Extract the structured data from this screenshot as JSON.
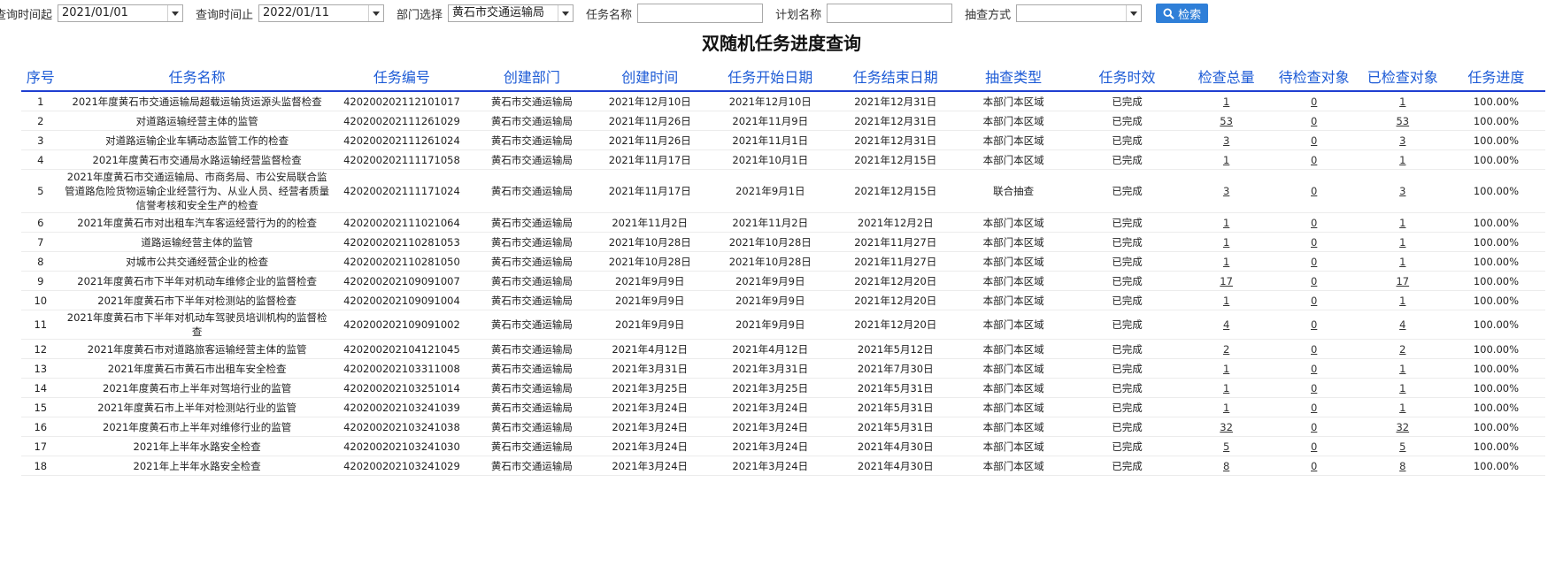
{
  "filters": {
    "start_label": "查询时间起",
    "start_value": "2021/01/01",
    "end_label": "查询时间止",
    "end_value": "2022/01/11",
    "dept_label": "部门选择",
    "dept_value": "黄石市交通运输局",
    "task_name_label": "任务名称",
    "task_name_value": "",
    "plan_name_label": "计划名称",
    "plan_name_value": "",
    "method_label": "抽查方式",
    "method_value": "",
    "search_label": "检索"
  },
  "title": "双随机任务进度查询",
  "columns": [
    "序号",
    "任务名称",
    "任务编号",
    "创建部门",
    "创建时间",
    "任务开始日期",
    "任务结束日期",
    "抽查类型",
    "任务时效",
    "检查总量",
    "待检查对象",
    "已检查对象",
    "任务进度"
  ],
  "rows": [
    {
      "no": "1",
      "name": "2021年度黄石市交通运输局超载运输货运源头监督检查",
      "code": "420200202112101017",
      "dept": "黄石市交通运输局",
      "created": "2021年12月10日",
      "start": "2021年12月10日",
      "end": "2021年12月31日",
      "type": "本部门本区域",
      "status": "已完成",
      "total": "1",
      "pending": "0",
      "checked": "1",
      "progress": "100.00%"
    },
    {
      "no": "2",
      "name": "对道路运输经营主体的监管",
      "code": "420200202111261029",
      "dept": "黄石市交通运输局",
      "created": "2021年11月26日",
      "start": "2021年11月9日",
      "end": "2021年12月31日",
      "type": "本部门本区域",
      "status": "已完成",
      "total": "53",
      "pending": "0",
      "checked": "53",
      "progress": "100.00%"
    },
    {
      "no": "3",
      "name": "对道路运输企业车辆动态监管工作的检查",
      "code": "420200202111261024",
      "dept": "黄石市交通运输局",
      "created": "2021年11月26日",
      "start": "2021年11月1日",
      "end": "2021年12月31日",
      "type": "本部门本区域",
      "status": "已完成",
      "total": "3",
      "pending": "0",
      "checked": "3",
      "progress": "100.00%"
    },
    {
      "no": "4",
      "name": "2021年度黄石市交通局水路运输经营监督检查",
      "code": "420200202111171058",
      "dept": "黄石市交通运输局",
      "created": "2021年11月17日",
      "start": "2021年10月1日",
      "end": "2021年12月15日",
      "type": "本部门本区域",
      "status": "已完成",
      "total": "1",
      "pending": "0",
      "checked": "1",
      "progress": "100.00%"
    },
    {
      "no": "5",
      "name": "2021年度黄石市交通运输局、市商务局、市公安局联合监管道路危险货物运输企业经营行为、从业人员、经营者质量信誉考核和安全生产的检查",
      "code": "420200202111171024",
      "dept": "黄石市交通运输局",
      "created": "2021年11月17日",
      "start": "2021年9月1日",
      "end": "2021年12月15日",
      "type": "联合抽查",
      "status": "已完成",
      "total": "3",
      "pending": "0",
      "checked": "3",
      "progress": "100.00%"
    },
    {
      "no": "6",
      "name": "2021年度黄石市对出租车汽车客运经营行为的的检查",
      "code": "420200202111021064",
      "dept": "黄石市交通运输局",
      "created": "2021年11月2日",
      "start": "2021年11月2日",
      "end": "2021年12月2日",
      "type": "本部门本区域",
      "status": "已完成",
      "total": "1",
      "pending": "0",
      "checked": "1",
      "progress": "100.00%"
    },
    {
      "no": "7",
      "name": "道路运输经营主体的监管",
      "code": "420200202110281053",
      "dept": "黄石市交通运输局",
      "created": "2021年10月28日",
      "start": "2021年10月28日",
      "end": "2021年11月27日",
      "type": "本部门本区域",
      "status": "已完成",
      "total": "1",
      "pending": "0",
      "checked": "1",
      "progress": "100.00%"
    },
    {
      "no": "8",
      "name": "对城市公共交通经营企业的检查",
      "code": "420200202110281050",
      "dept": "黄石市交通运输局",
      "created": "2021年10月28日",
      "start": "2021年10月28日",
      "end": "2021年11月27日",
      "type": "本部门本区域",
      "status": "已完成",
      "total": "1",
      "pending": "0",
      "checked": "1",
      "progress": "100.00%"
    },
    {
      "no": "9",
      "name": "2021年度黄石市下半年对机动车维修企业的监督检查",
      "code": "420200202109091007",
      "dept": "黄石市交通运输局",
      "created": "2021年9月9日",
      "start": "2021年9月9日",
      "end": "2021年12月20日",
      "type": "本部门本区域",
      "status": "已完成",
      "total": "17",
      "pending": "0",
      "checked": "17",
      "progress": "100.00%"
    },
    {
      "no": "10",
      "name": "2021年度黄石市下半年对检测站的监督检查",
      "code": "420200202109091004",
      "dept": "黄石市交通运输局",
      "created": "2021年9月9日",
      "start": "2021年9月9日",
      "end": "2021年12月20日",
      "type": "本部门本区域",
      "status": "已完成",
      "total": "1",
      "pending": "0",
      "checked": "1",
      "progress": "100.00%"
    },
    {
      "no": "11",
      "name": "2021年度黄石市下半年对机动车驾驶员培训机构的监督检查",
      "code": "420200202109091002",
      "dept": "黄石市交通运输局",
      "created": "2021年9月9日",
      "start": "2021年9月9日",
      "end": "2021年12月20日",
      "type": "本部门本区域",
      "status": "已完成",
      "total": "4",
      "pending": "0",
      "checked": "4",
      "progress": "100.00%"
    },
    {
      "no": "12",
      "name": "2021年度黄石市对道路旅客运输经营主体的监管",
      "code": "420200202104121045",
      "dept": "黄石市交通运输局",
      "created": "2021年4月12日",
      "start": "2021年4月12日",
      "end": "2021年5月12日",
      "type": "本部门本区域",
      "status": "已完成",
      "total": "2",
      "pending": "0",
      "checked": "2",
      "progress": "100.00%"
    },
    {
      "no": "13",
      "name": "2021年度黄石市黄石市出租车安全检查",
      "code": "420200202103311008",
      "dept": "黄石市交通运输局",
      "created": "2021年3月31日",
      "start": "2021年3月31日",
      "end": "2021年7月30日",
      "type": "本部门本区域",
      "status": "已完成",
      "total": "1",
      "pending": "0",
      "checked": "1",
      "progress": "100.00%"
    },
    {
      "no": "14",
      "name": "2021年度黄石市上半年对驾培行业的监管",
      "code": "420200202103251014",
      "dept": "黄石市交通运输局",
      "created": "2021年3月25日",
      "start": "2021年3月25日",
      "end": "2021年5月31日",
      "type": "本部门本区域",
      "status": "已完成",
      "total": "1",
      "pending": "0",
      "checked": "1",
      "progress": "100.00%"
    },
    {
      "no": "15",
      "name": "2021年度黄石市上半年对检测站行业的监管",
      "code": "420200202103241039",
      "dept": "黄石市交通运输局",
      "created": "2021年3月24日",
      "start": "2021年3月24日",
      "end": "2021年5月31日",
      "type": "本部门本区域",
      "status": "已完成",
      "total": "1",
      "pending": "0",
      "checked": "1",
      "progress": "100.00%"
    },
    {
      "no": "16",
      "name": "2021年度黄石市上半年对维修行业的监管",
      "code": "420200202103241038",
      "dept": "黄石市交通运输局",
      "created": "2021年3月24日",
      "start": "2021年3月24日",
      "end": "2021年5月31日",
      "type": "本部门本区域",
      "status": "已完成",
      "total": "32",
      "pending": "0",
      "checked": "32",
      "progress": "100.00%"
    },
    {
      "no": "17",
      "name": "2021年上半年水路安全检查",
      "code": "420200202103241030",
      "dept": "黄石市交通运输局",
      "created": "2021年3月24日",
      "start": "2021年3月24日",
      "end": "2021年4月30日",
      "type": "本部门本区域",
      "status": "已完成",
      "total": "5",
      "pending": "0",
      "checked": "5",
      "progress": "100.00%"
    },
    {
      "no": "18",
      "name": "2021年上半年水路安全检查",
      "code": "420200202103241029",
      "dept": "黄石市交通运输局",
      "created": "2021年3月24日",
      "start": "2021年3月24日",
      "end": "2021年4月30日",
      "type": "本部门本区域",
      "status": "已完成",
      "total": "8",
      "pending": "0",
      "checked": "8",
      "progress": "100.00%"
    }
  ]
}
